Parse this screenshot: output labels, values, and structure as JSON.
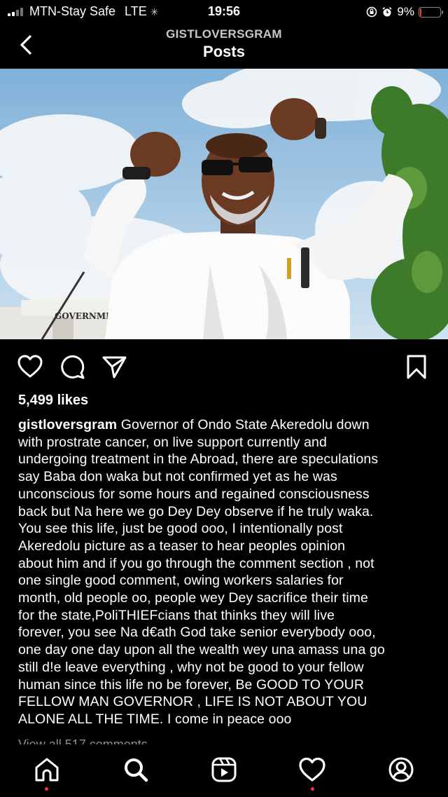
{
  "status_bar": {
    "carrier": "MTN-Stay Safe",
    "network": "LTE",
    "time": "19:56",
    "battery_percent": "9%",
    "battery_level": 0.09,
    "battery_color": "#ff3b30"
  },
  "header": {
    "account_name": "GISTLOVERSGRAM",
    "title": "Posts"
  },
  "post": {
    "image_sign_text": "GOVERNMENT HOUSE",
    "likes": "5,499 likes",
    "username": "gistloversgram",
    "caption_lines": [
      "Governor of Ondo State Akeredolu down",
      "with prostrate cancer, on live support currently and",
      "undergoing treatment in the Abroad, there are speculations",
      "say Baba don waka but not confirmed yet as he was",
      "unconscious for some hours and regained consciousness",
      "back but Na here we go Dey Dey observe if he truly waka.",
      "You see this life, just be good ooo, I intentionally post",
      "Akeredolu picture as a teaser to hear peoples opinion",
      "about him and if you go through the comment section , not",
      "one single good comment, owing workers salaries for",
      "month, old people oo, people wey Dey sacrifice their time",
      "for the state,PoliTHIEFcians that thinks they will live",
      "forever, you see Na d€ath God take senior everybody ooo,",
      "one day one day upon all the wealth wey una amass una go",
      "still d!e leave everything , why not be good to your fellow",
      "human since this life no be forever, Be GOOD TO YOUR",
      "FELLOW MAN GOVERNOR , LIFE IS NOT ABOUT YOU",
      "ALONE ALL THE TIME. I come in peace ooo"
    ],
    "view_comments": "View all 517 comments"
  },
  "icons": {
    "back": "chevron-left-icon",
    "like": "heart-icon",
    "comment": "comment-bubble-icon",
    "share": "paper-plane-icon",
    "save": "bookmark-icon"
  },
  "bottom_nav": [
    {
      "name": "home",
      "icon": "home-icon",
      "notification_dot": true
    },
    {
      "name": "search",
      "icon": "search-icon",
      "notification_dot": false
    },
    {
      "name": "reels",
      "icon": "reels-icon",
      "notification_dot": false
    },
    {
      "name": "activity",
      "icon": "heart-icon",
      "notification_dot": true
    },
    {
      "name": "profile",
      "icon": "profile-icon",
      "notification_dot": false
    }
  ]
}
